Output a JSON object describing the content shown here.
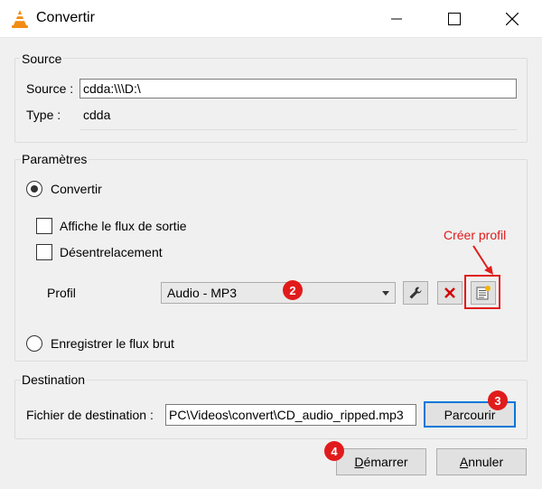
{
  "window": {
    "title": "Convertir",
    "controls": {
      "minimize": "minimize-icon",
      "maximize": "maximize-icon",
      "close": "close-icon"
    }
  },
  "source": {
    "group_title": "Source",
    "source_label": "Source :",
    "source_value": "cdda:\\\\\\D:\\",
    "type_label": "Type :",
    "type_value": "cdda"
  },
  "params": {
    "group_title": "Paramètres",
    "convert_label": "Convertir",
    "show_output_label": "Affiche le flux de sortie",
    "deinterlace_label": "Désentrelacement",
    "profile_label": "Profil",
    "profile_value": "Audio - MP3",
    "raw_dump_label": "Enregistrer le flux brut"
  },
  "destination": {
    "group_title": "Destination",
    "file_label": "Fichier de destination :",
    "file_value": "PC\\Videos\\convert\\CD_audio_ripped.mp3",
    "browse_label": "Parcourir"
  },
  "buttons": {
    "start_prefix": "",
    "start_underlined": "D",
    "start_rest": "émarrer",
    "cancel_underlined": "A",
    "cancel_rest": "nnuler"
  },
  "annotations": {
    "create_profile_text": "Créer profil",
    "badge_2": "2",
    "badge_3": "3",
    "badge_4": "4",
    "color": "#e11b1b"
  },
  "colors": {
    "accent": "#0078d7",
    "window_bg": "#f0f0f0"
  }
}
